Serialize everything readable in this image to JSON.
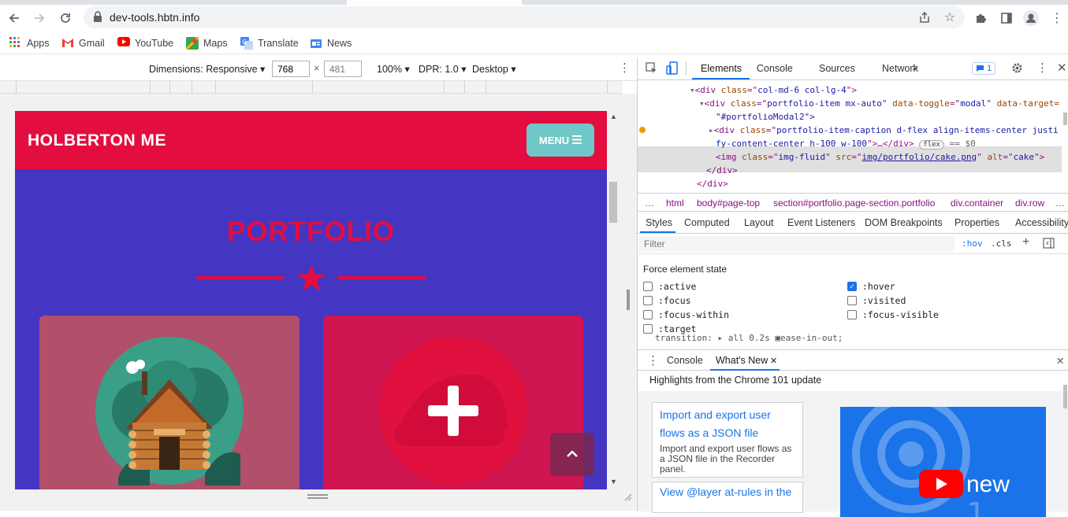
{
  "browser": {
    "url": "dev-tools.hbtn.info",
    "bookmarks": [
      {
        "label": "Apps",
        "icon": "apps-grid-icon"
      },
      {
        "label": "Gmail",
        "icon": "gmail-icon"
      },
      {
        "label": "YouTube",
        "icon": "youtube-icon"
      },
      {
        "label": "Maps",
        "icon": "maps-icon"
      },
      {
        "label": "Translate",
        "icon": "translate-icon"
      },
      {
        "label": "News",
        "icon": "news-icon"
      }
    ]
  },
  "device_toolbar": {
    "dimensions_label": "Dimensions: Responsive",
    "width_value": "768",
    "height_placeholder": "481",
    "times": "×",
    "zoom": "100%",
    "dpr": "DPR: 1.0",
    "mode": "Desktop"
  },
  "site": {
    "brand": "HOLBERTON ME",
    "menu_label": "MENU",
    "section_title": "PORTFOLIO",
    "colors": {
      "nav": "#e30d3f",
      "body": "#4436c3",
      "menu": "#70c7c7"
    }
  },
  "devtools": {
    "tabs": [
      "Elements",
      "Console",
      "Sources",
      "Network"
    ],
    "more_tabs": "»",
    "issues_count": "1",
    "dom": {
      "line1": {
        "open": "<div ",
        "attr": "class",
        "eq": "=\"",
        "val": "col-md-6 col-lg-4",
        "close": "\">"
      },
      "line2a": {
        "open": "<div ",
        "a1": "class",
        "v1": "portfolio-item mx-auto",
        "a2": "data-toggle",
        "v2": "modal",
        "a3": "data-target="
      },
      "line2b": "\"#portfolioModal2\">",
      "line3a": {
        "open": "<div ",
        "attr": "class",
        "val": "portfolio-item-caption d-flex align-items-center justi"
      },
      "line3b": {
        "val": "fy-content-center h-100 w-100",
        "rest": "\">…</div>",
        "badge": "flex",
        "eq": "== $0"
      },
      "line4": {
        "open": "<img ",
        "a1": "class",
        "v1": "img-fluid",
        "a2": "src",
        "v2": "img/portfolio/cake.png",
        "a3": "alt",
        "v3": "cake",
        "close": "\">"
      },
      "line5": "</div>",
      "line6": "</div>"
    },
    "breadcrumbs": [
      "…",
      "html",
      "body#page-top",
      "section#portfolio.page-section.portfolio",
      "div.container",
      "div.row",
      "…"
    ],
    "styles_tabs": [
      "Styles",
      "Computed",
      "Layout",
      "Event Listeners",
      "DOM Breakpoints",
      "Properties",
      "Accessibility"
    ],
    "filter_placeholder": "Filter",
    "hov": ":hov",
    "cls": ".cls",
    "plus": "+",
    "force_title": "Force element state",
    "states": [
      {
        "label": ":active",
        "checked": false
      },
      {
        "label": ":hover",
        "checked": true
      },
      {
        "label": ":focus",
        "checked": false
      },
      {
        "label": ":visited",
        "checked": false
      },
      {
        "label": ":focus-within",
        "checked": false
      },
      {
        "label": ":focus-visible",
        "checked": false
      },
      {
        "label": ":target",
        "checked": false
      }
    ],
    "transition_line": "transition: ▸ all 0.2s ▣ease-in-out;",
    "drawer_tabs": [
      "Console",
      "What's New"
    ],
    "highlights": "Highlights from the Chrome 101 update",
    "feature1_title": "Import and export user flows as a JSON file",
    "feature1_desc": "Import and export user flows as a JSON file in the Recorder panel.",
    "feature2_title": "View @layer at-rules in the",
    "video_text": "new"
  }
}
